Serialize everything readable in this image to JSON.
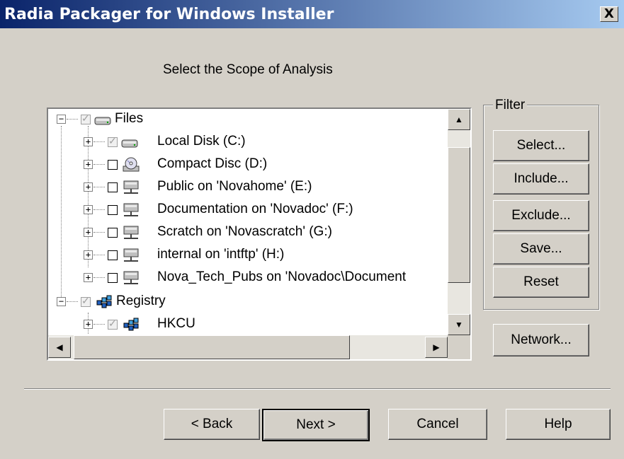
{
  "window": {
    "title": "Radia Packager for Windows Installer",
    "close_label": "X"
  },
  "heading": "Select the Scope of Analysis",
  "tree": {
    "items": [
      {
        "label": "Files",
        "expander": "−",
        "checked": "partial",
        "icon": "drive-icon"
      },
      {
        "label": "Local Disk (C:)",
        "expander": "+",
        "checked": "partial",
        "icon": "drive-icon"
      },
      {
        "label": "Compact Disc (D:)",
        "expander": "+",
        "checked": "no",
        "icon": "cd-drive-icon"
      },
      {
        "label": "Public on 'Novahome' (E:)",
        "expander": "+",
        "checked": "no",
        "icon": "network-drive-icon"
      },
      {
        "label": "Documentation on 'Novadoc' (F:)",
        "expander": "+",
        "checked": "no",
        "icon": "network-drive-icon"
      },
      {
        "label": "Scratch on 'Novascratch' (G:)",
        "expander": "+",
        "checked": "no",
        "icon": "network-drive-icon"
      },
      {
        "label": "internal on 'intftp' (H:)",
        "expander": "+",
        "checked": "no",
        "icon": "network-drive-icon"
      },
      {
        "label": "Nova_Tech_Pubs on 'Novadoc\\Document",
        "expander": "+",
        "checked": "no",
        "icon": "network-drive-icon"
      },
      {
        "label": "Registry",
        "expander": "−",
        "checked": "partial",
        "icon": "registry-icon"
      },
      {
        "label": "HKCU",
        "expander": "+",
        "checked": "partial",
        "icon": "registry-icon"
      }
    ]
  },
  "scroll": {
    "up": "▲",
    "down": "▼",
    "left": "◀",
    "right": "▶"
  },
  "filter": {
    "label": "Filter",
    "select": "Select...",
    "include": "Include...",
    "exclude": "Exclude...",
    "save": "Save...",
    "reset": "Reset"
  },
  "network": "Network...",
  "footer": {
    "back": "< Back",
    "next": "Next >",
    "cancel": "Cancel",
    "help": "Help"
  },
  "colors": {
    "title_start": "#0a246a",
    "title_end": "#a6caf0",
    "face": "#d4d0c8"
  }
}
